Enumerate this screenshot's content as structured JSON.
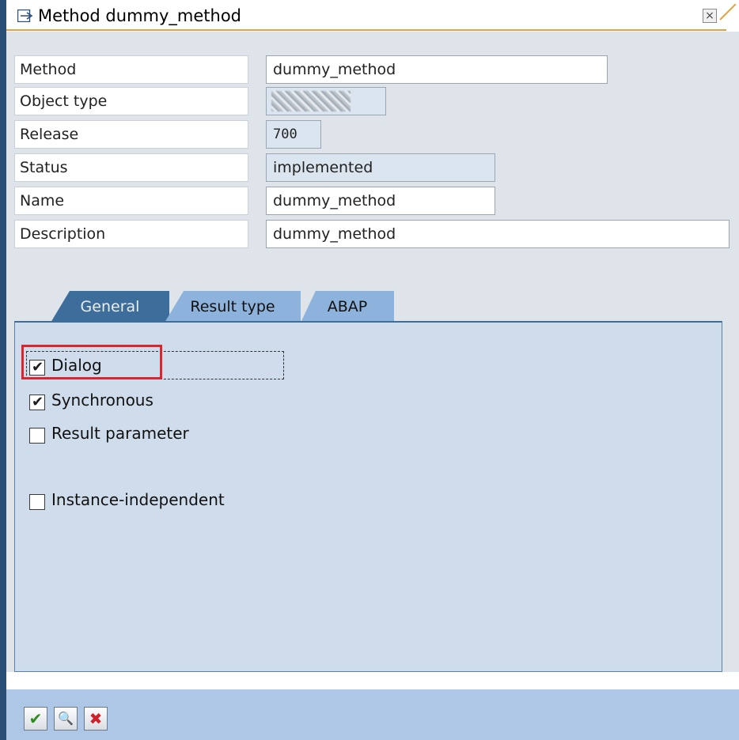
{
  "window": {
    "title": "Method dummy_method",
    "close_label": "×"
  },
  "fields": [
    {
      "label": "Method",
      "value": "dummy_method"
    },
    {
      "label": "Object type",
      "value": ""
    },
    {
      "label": "Release",
      "value": "700"
    },
    {
      "label": "Status",
      "value": "implemented"
    },
    {
      "label": "Name",
      "value": "dummy_method"
    },
    {
      "label": "Description",
      "value": "dummy_method"
    }
  ],
  "tabs": [
    {
      "label": "General",
      "active": true
    },
    {
      "label": "Result type",
      "active": false
    },
    {
      "label": "ABAP",
      "active": false
    }
  ],
  "checkboxes": [
    {
      "label": "Dialog",
      "checked": true
    },
    {
      "label": "Synchronous",
      "checked": true
    },
    {
      "label": "Result parameter",
      "checked": false
    },
    {
      "label": "Instance-independent",
      "checked": false
    }
  ],
  "footer": {
    "buttons": [
      {
        "icon": "checkmark-icon",
        "glyph": "✔",
        "color": "#2e8b1f"
      },
      {
        "icon": "magnifier-icon",
        "glyph": "🔍",
        "color": "#1f4f8b"
      },
      {
        "icon": "cancel-icon",
        "glyph": "✖",
        "color": "#d0202a"
      }
    ]
  },
  "colors": {
    "accent": "#3d6d9b",
    "highlight": "#e0232a",
    "title_underline": "#e6a23c"
  }
}
